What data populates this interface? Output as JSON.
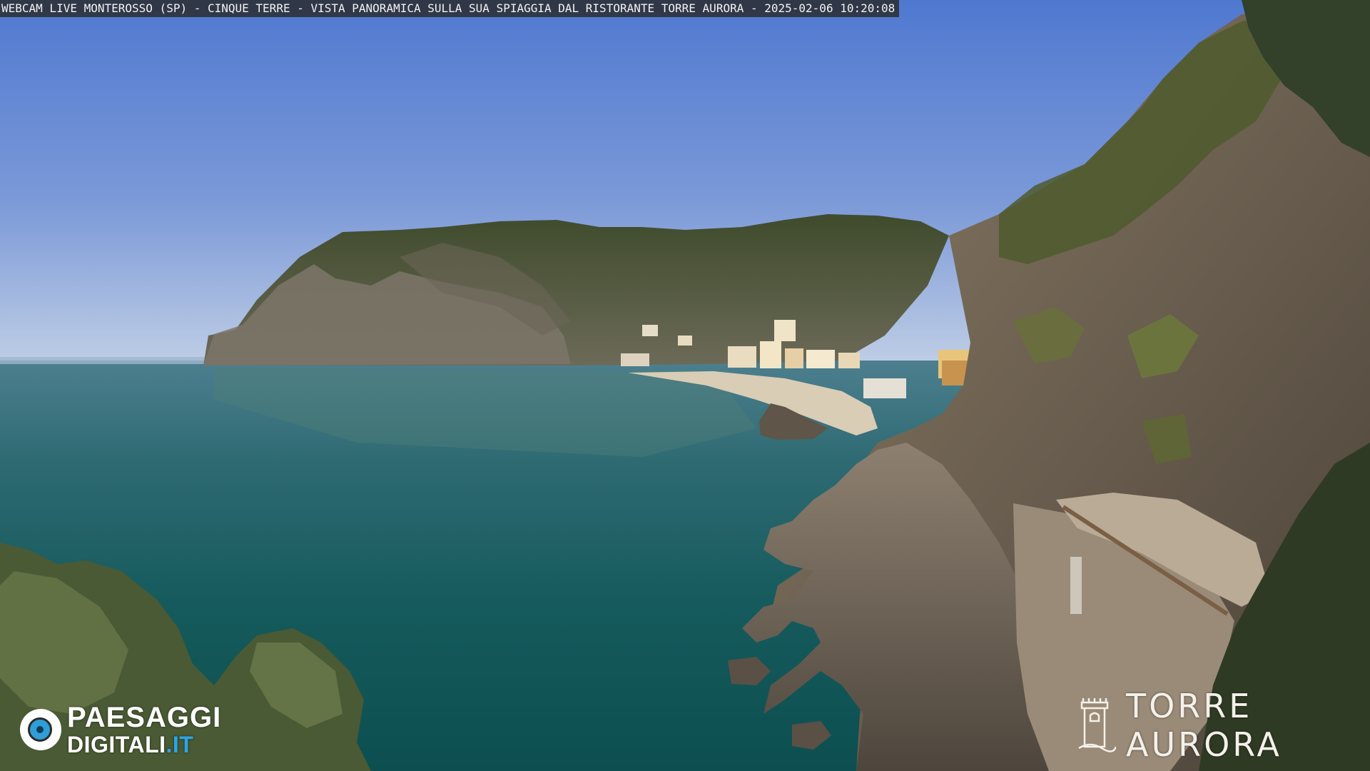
{
  "overlay": {
    "caption": "WEBCAM LIVE MONTEROSSO (SP) - CINQUE TERRE - VISTA PANORAMICA SULLA SUA SPIAGGIA DAL RISTORANTE TORRE AURORA - 2025-02-06 10:20:08"
  },
  "logos": {
    "left_line1": "PAESAGGI",
    "left_line2_main": "DIGITALI",
    "left_line2_tld": ".IT",
    "right_text": "TORRE AURORA",
    "left_icon": "eye-logo-icon",
    "right_icon": "tower-logo-icon"
  },
  "colors": {
    "sky_top": "#5f84d6",
    "sky_horizon": "#b9cbe6",
    "sea_deep": "#0f4c4c",
    "sea_light": "#3d7c85",
    "headland": "#4e5a3a",
    "cliff_rock": "#7a6e5e",
    "logo_accent": "#2aa6e8"
  }
}
